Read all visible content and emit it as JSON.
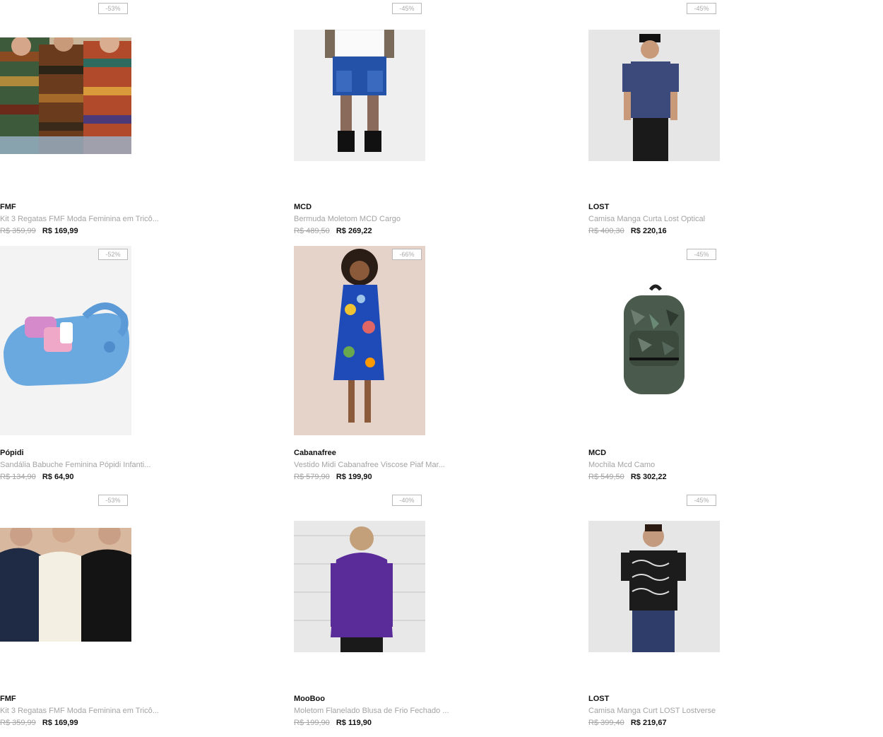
{
  "products": [
    {
      "discount": "-53%",
      "brand": "FMF",
      "name": "Kit 3 Regatas FMF Moda Feminina em Tricô...",
      "old_price": "R$ 359,99",
      "new_price": "R$ 169,99",
      "image": "striped-knit-tanks-photo"
    },
    {
      "discount": "-45%",
      "brand": "MCD",
      "name": "Bermuda Moletom MCD Cargo",
      "old_price": "R$ 489,50",
      "new_price": "R$ 269,22",
      "image": "blue-cargo-shorts-photo"
    },
    {
      "discount": "-45%",
      "brand": "LOST",
      "name": "Camisa Manga Curta Lost Optical",
      "old_price": "R$ 400,30",
      "new_price": "R$ 220,16",
      "image": "blue-short-sleeve-shirt-photo"
    },
    {
      "discount": "-52%",
      "brand": "Pópidi",
      "name": "Sandália Babuche Feminina Pópidi Infanti...",
      "old_price": "R$ 134,90",
      "new_price": "R$ 64,90",
      "image": "blue-kids-clog-photo"
    },
    {
      "discount": "-66%",
      "brand": "Cabanafree",
      "name": "Vestido Midi Cabanafree Viscose Piaf Mar...",
      "old_price": "R$ 579,90",
      "new_price": "R$ 199,90",
      "image": "floral-midi-dress-photo"
    },
    {
      "discount": "-45%",
      "brand": "MCD",
      "name": "Mochila Mcd Camo",
      "old_price": "R$ 549,50",
      "new_price": "R$ 302,22",
      "image": "camo-backpack-photo"
    },
    {
      "discount": "-53%",
      "brand": "FMF",
      "name": "Kit 3 Regatas FMF Moda Feminina em Tricô...",
      "old_price": "R$ 359,99",
      "new_price": "R$ 169,99",
      "image": "plain-knit-tanks-photo"
    },
    {
      "discount": "-40%",
      "brand": "MooBoo",
      "name": "Moletom Flanelado Blusa de Frio Fechado ...",
      "old_price": "R$ 199,90",
      "new_price": "R$ 119,90",
      "image": "purple-hoodie-photo"
    },
    {
      "discount": "-45%",
      "brand": "LOST",
      "name": "Camisa Manga Curt LOST Lostverse",
      "old_price": "R$ 399,40",
      "new_price": "R$ 219,67",
      "image": "black-pattern-shirt-photo"
    }
  ]
}
